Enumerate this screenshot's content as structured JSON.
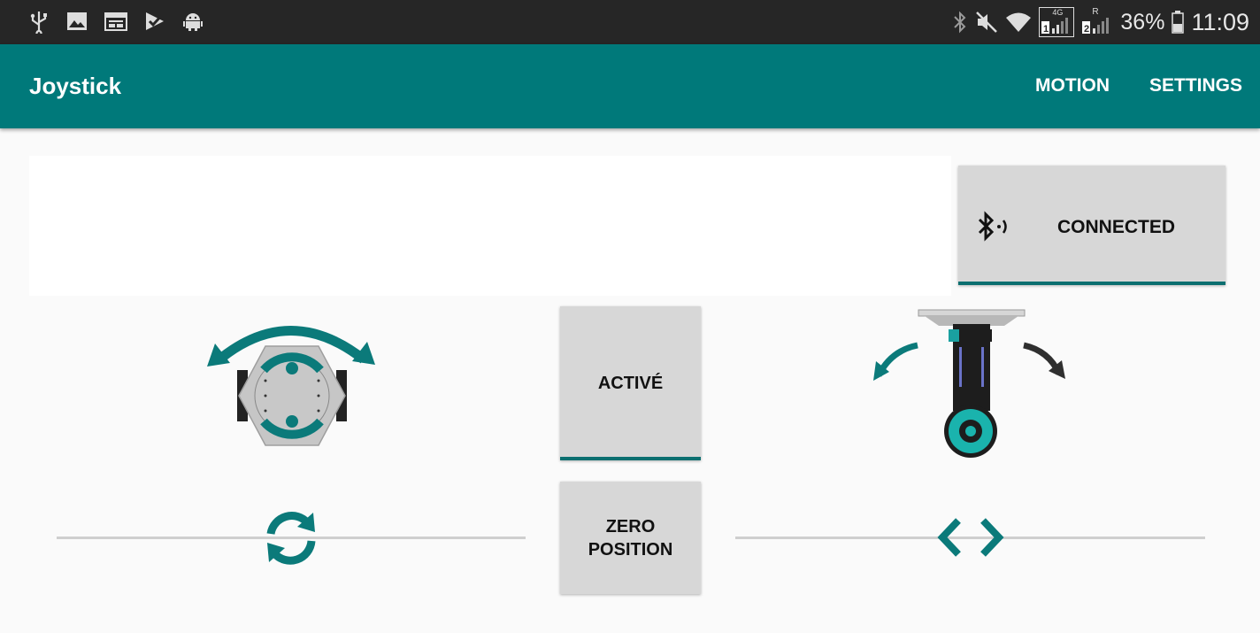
{
  "status_bar": {
    "battery": "36%",
    "time": "11:09",
    "network_label": "4G",
    "sim2_label": "R",
    "icons": [
      "usb-icon",
      "image-icon",
      "calendar-icon",
      "play-store-icon",
      "android-icon",
      "bluetooth-icon",
      "mute-icon",
      "wifi-icon",
      "signal-sim1-icon",
      "signal-sim2-icon",
      "battery-icon"
    ]
  },
  "app_bar": {
    "title": "Joystick",
    "menu": [
      "MOTION",
      "SETTINGS"
    ]
  },
  "main": {
    "connection_button": {
      "label": "CONNECTED",
      "icon": "bluetooth-connected-icon"
    },
    "active_button": {
      "label": "ACTIVÉ"
    },
    "zero_button": {
      "label_line1": "ZERO",
      "label_line2": "POSITION"
    },
    "left_graphic": {
      "icon": "rotation-module-icon"
    },
    "right_graphic": {
      "icon": "tilt-arm-icon"
    },
    "left_slider": {
      "icon": "rotate-sync-icon",
      "value": 0.5
    },
    "right_slider": {
      "icon": "left-right-arrows-icon",
      "value": 0.5
    }
  },
  "colors": {
    "accent": "#00797a",
    "dark_teal": "#0b6f70",
    "statusbar": "#262626"
  }
}
